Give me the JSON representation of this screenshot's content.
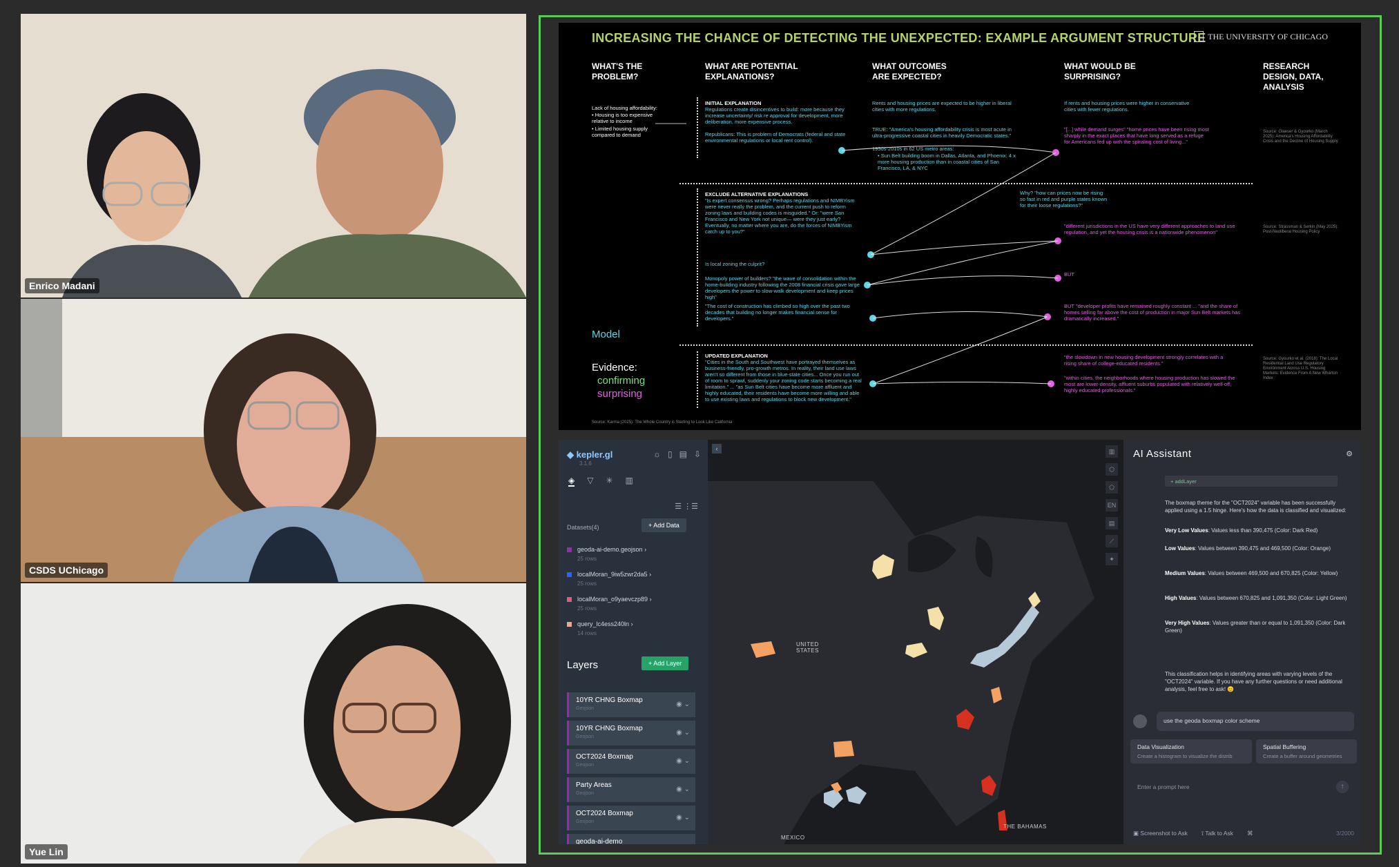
{
  "participants": [
    {
      "name": "Enrico Madani",
      "active": true
    },
    {
      "name": "CSDS UChicago",
      "active": false
    },
    {
      "name": "Yue Lin",
      "active": false
    }
  ],
  "slide": {
    "title": "INCREASING THE CHANCE OF DETECTING THE UNEXPECTED: EXAMPLE ARGUMENT STRUCTURE",
    "logo": "THE UNIVERSITY OF CHICAGO",
    "columns": [
      "WHAT'S THE PROBLEM?",
      "WHAT ARE POTENTIAL EXPLANATIONS?",
      "WHAT OUTCOMES ARE EXPECTED?",
      "WHAT WOULD BE SURPRISING?",
      "RESEARCH DESIGN, DATA, ANALYSIS"
    ],
    "problem": {
      "intro": "Lack of housing affordability:",
      "bullets": [
        "Housing is too expensive relative to income",
        "Limited housing supply compared to demand"
      ]
    },
    "initial_heading": "INITIAL EXPLANATION",
    "initial_text": "Regulations create disincentives to build: more because they increase uncertainty/ risk re approval for development, more deliberation, more expensive process.",
    "initial_text2": "Republicans: This is problem of Democrats (federal and state environmental regulations or local rent control).",
    "expected1": "Rents and housing prices are expected to be higher in liberal cities with more regulations.",
    "expected2": "TRUE: \"America's housing affordability crisis is most acute in ultra-progressive coastal cities in heavily Democratic states.\"",
    "expected3": "1950s-2010s in 62 US metro areas:",
    "expected4": "Sun Belt building boom in Dallas, Atlanta, and Phoenix: 4 x more housing production than in coastal cities of San Francisco, LA, & NYC",
    "surprising1": "If rents and housing prices were higher in conservative cities with fewer regulations.",
    "surprising2": "\"[...] while demand surges\" \"home prices have been rising most sharply in the exact places that have long served as a refuge for Americans fed up with the spiraling cost of living...\"",
    "source1": "Source: Glaeser & Gyourko (March 2025): America's Housing Affordability Crisis and the Decline of Housing Supply",
    "exclude_heading": "EXCLUDE ALTERNATIVE EXPLANATIONS",
    "exclude_text": "\"Is expert consensus wrong? Perhaps regulations and NIMBYism were never really the problem, and the current push to reform zoning laws and building codes is misguided.\" Or: \"were San Francisco and New York not unique— were they just early? Eventually, no matter where you are, do the forces of NIMBYism catch up to you?\"",
    "why_text": "Why? \"how can prices now be rising so fast in red and purple states known for their loose regulations?\"",
    "sur_mid": "\"different jurisdictions in the US have very different approaches to land use regulation, and yet the housing crisis is a nationwide phenomenon\"",
    "source2": "Source: Strassman & Serkin (May 2025): Post-Neoliberal Housing Policy",
    "local_zoning": "Is local zoning the culprit?",
    "monopoly": "Monopoly power of builders? \"the wave of consolidation within the home-building industry following the 2008 financial crisis gave large developers the power to slow-walk development and keep prices high\"",
    "but1": "BUT",
    "construction": "\"The cost of construction has climbed so high over the past two decades that building no longer makes financial sense for developers.\"",
    "but2": "BUT \"developer profits have remained roughly constant ... \"and the share of homes selling far above the cost of production in major Sun Belt markets has dramatically increased.\"",
    "model": "Model",
    "evidence": "Evidence:",
    "confirming": "confirming",
    "surprising": "surprising",
    "updated_heading": "UPDATED EXPLANATION",
    "updated_text": "\"Cities in the South and Southwest have portrayed themselves as business-friendly, pro-growth metros. In reality, their land use laws aren't so different from those in blue-state cities... Once you run out of room to sprawl, suddenly your zoning code starts becoming a real limitation.\" ... \"as Sun Belt cities have become more affluent and highly educated, their residents have become more willing and able to use existing laws and regulations to block new development.\"",
    "evid1": "\"the slowdown in new housing development strongly correlates with a rising share of college-educated residents.\"",
    "evid2": "\"within cities, the neighborhoods where housing production has slowed the most are lower-density, affluent suburbs populated with relatively well-off, highly educated professionals.\"",
    "source3": "Source: Gyourko et al. (2018): The Local Residential Land Use Regulatory Environment Across U.S. Housing Markets: Evidence From A New Wharton Index",
    "footer_source": "Source: Karma (2025): The Whole Country is Starting to Look Like California"
  },
  "kepler": {
    "brand": "kepler.gl",
    "version": "3.1.6",
    "datasets_label": "Datasets(4)",
    "add_data": "Add Data",
    "datasets": [
      {
        "name": "geoda-ai-demo.geojson",
        "rows": "25 rows",
        "color": "#9c27b0"
      },
      {
        "name": "localMoran_9iw5zwr2da5",
        "rows": "25 rows",
        "color": "#2962ff"
      },
      {
        "name": "localMoran_o9yaevczp89",
        "rows": "25 rows",
        "color": "#d9607b"
      },
      {
        "name": "query_lc4ess240ln",
        "rows": "14 rows",
        "color": "#f4a582"
      }
    ],
    "layers_label": "Layers",
    "add_layer": "Add Layer",
    "layers": [
      {
        "name": "10YR CHNG Boxmap",
        "type": "Geojson"
      },
      {
        "name": "10YR CHNG Boxmap",
        "type": "Geojson"
      },
      {
        "name": "OCT2024 Boxmap",
        "type": "Geojson"
      },
      {
        "name": "Party Areas",
        "type": "Geojson"
      },
      {
        "name": "OCT2024 Boxmap",
        "type": "Geojson"
      },
      {
        "name": "geoda-ai-demo",
        "type": ""
      }
    ],
    "map_labels": {
      "us": "UNITED STATES",
      "mexico": "MEXICO",
      "bahamas": "THE BAHAMAS"
    }
  },
  "ai": {
    "title": "AI Assistant",
    "tool_chip": "+ addLayer",
    "intro": "The boxmap theme for the \"OCT2024\" variable has been successfully applied using a 1.5 hinge. Here's how the data is classified and visualized:",
    "classes": [
      {
        "label": "Very Low Values",
        "text": ": Values less than 390,475 (Color: Dark Red)"
      },
      {
        "label": "Low Values",
        "text": ": Values between 390,475 and 469,500 (Color: Orange)"
      },
      {
        "label": "Medium Values",
        "text": ": Values between 469,500 and 670,825 (Color: Yellow)"
      },
      {
        "label": "High Values",
        "text": ": Values between 670,825 and 1,091,350 (Color: Light Green)"
      },
      {
        "label": "Very High Values",
        "text": ": Values greater than or equal to 1,091,350 (Color: Dark Green)"
      }
    ],
    "outro": "This classification helps in identifying areas with varying levels of the \"OCT2024\" variable. If you have any further questions or need additional analysis, feel free to ask! 😊",
    "user_message": "use the geoda boxmap color scheme",
    "suggestions": [
      {
        "title": "Data Visualization",
        "desc": "Create a histogram to visualize the distrib"
      },
      {
        "title": "Spatial Buffering",
        "desc": "Create a buffer around geometries"
      }
    ],
    "prompt_placeholder": "Enter a prompt here",
    "screenshot_btn": "Screenshot to Ask",
    "talk_btn": "Talk to Ask",
    "counter": "3/2000"
  },
  "colors": {
    "active_border": "#5ccb58",
    "cyan": "#5fd6e6",
    "magenta": "#e261e2",
    "title_green": "#b6d36b"
  }
}
